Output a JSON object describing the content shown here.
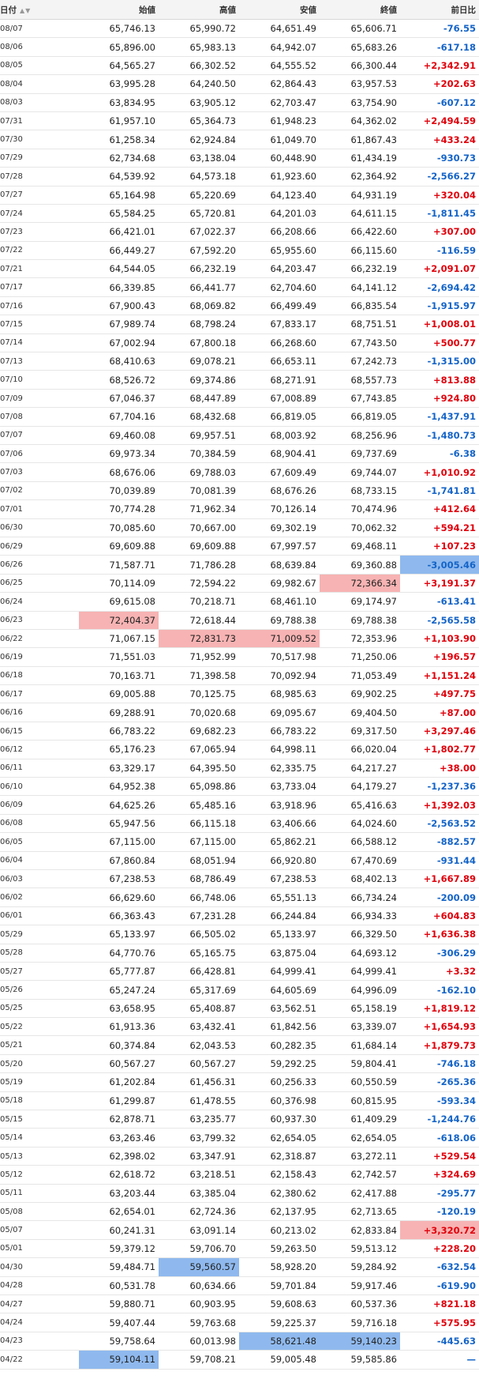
{
  "table": {
    "headers": [
      "日付",
      "始値",
      "高値",
      "安値",
      "終値",
      "前日比"
    ],
    "rows": [
      [
        "08/07",
        "65,746.13",
        "65,990.72",
        "64,651.49",
        "65,606.71",
        "-76.55"
      ],
      [
        "08/06",
        "65,896.00",
        "65,983.13",
        "64,942.07",
        "65,683.26",
        "-617.18"
      ],
      [
        "08/05",
        "64,565.27",
        "66,302.52",
        "64,555.52",
        "66,300.44",
        "+2,342.91"
      ],
      [
        "08/04",
        "63,995.28",
        "64,240.50",
        "62,864.43",
        "63,957.53",
        "+202.63"
      ],
      [
        "08/03",
        "63,834.95",
        "63,905.12",
        "62,703.47",
        "63,754.90",
        "-607.12"
      ],
      [
        "07/31",
        "61,957.10",
        "65,364.73",
        "61,948.23",
        "64,362.02",
        "+2,494.59"
      ],
      [
        "07/30",
        "61,258.34",
        "62,924.84",
        "61,049.70",
        "61,867.43",
        "+433.24"
      ],
      [
        "07/29",
        "62,734.68",
        "63,138.04",
        "60,448.90",
        "61,434.19",
        "-930.73"
      ],
      [
        "07/28",
        "64,539.92",
        "64,573.18",
        "61,923.60",
        "62,364.92",
        "-2,566.27"
      ],
      [
        "07/27",
        "65,164.98",
        "65,220.69",
        "64,123.40",
        "64,931.19",
        "+320.04"
      ],
      [
        "07/24",
        "65,584.25",
        "65,720.81",
        "64,201.03",
        "64,611.15",
        "-1,811.45"
      ],
      [
        "07/23",
        "66,421.01",
        "67,022.37",
        "66,208.66",
        "66,422.60",
        "+307.00"
      ],
      [
        "07/22",
        "66,449.27",
        "67,592.20",
        "65,955.60",
        "66,115.60",
        "-116.59"
      ],
      [
        "07/21",
        "64,544.05",
        "66,232.19",
        "64,203.47",
        "66,232.19",
        "+2,091.07"
      ],
      [
        "07/17",
        "66,339.85",
        "66,441.77",
        "62,704.60",
        "64,141.12",
        "-2,694.42"
      ],
      [
        "07/16",
        "67,900.43",
        "68,069.82",
        "66,499.49",
        "66,835.54",
        "-1,915.97"
      ],
      [
        "07/15",
        "67,989.74",
        "68,798.24",
        "67,833.17",
        "68,751.51",
        "+1,008.01"
      ],
      [
        "07/14",
        "67,002.94",
        "67,800.18",
        "66,268.60",
        "67,743.50",
        "+500.77"
      ],
      [
        "07/13",
        "68,410.63",
        "69,078.21",
        "66,653.11",
        "67,242.73",
        "-1,315.00"
      ],
      [
        "07/10",
        "68,526.72",
        "69,374.86",
        "68,271.91",
        "68,557.73",
        "+813.88"
      ],
      [
        "07/09",
        "67,046.37",
        "68,447.89",
        "67,008.89",
        "67,743.85",
        "+924.80"
      ],
      [
        "07/08",
        "67,704.16",
        "68,432.68",
        "66,819.05",
        "66,819.05",
        "-1,437.91"
      ],
      [
        "07/07",
        "69,460.08",
        "69,957.51",
        "68,003.92",
        "68,256.96",
        "-1,480.73"
      ],
      [
        "07/06",
        "69,973.34",
        "70,384.59",
        "68,904.41",
        "69,737.69",
        "-6.38"
      ],
      [
        "07/03",
        "68,676.06",
        "69,788.03",
        "67,609.49",
        "69,744.07",
        "+1,010.92"
      ],
      [
        "07/02",
        "70,039.89",
        "70,081.39",
        "68,676.26",
        "68,733.15",
        "-1,741.81"
      ],
      [
        "07/01",
        "70,774.28",
        "71,962.34",
        "70,126.14",
        "70,474.96",
        "+412.64"
      ],
      [
        "06/30",
        "70,085.60",
        "70,667.00",
        "69,302.19",
        "70,062.32",
        "+594.21"
      ],
      [
        "06/29",
        "69,609.88",
        "69,609.88",
        "67,997.57",
        "69,468.11",
        "+107.23"
      ],
      [
        "06/26",
        "71,587.71",
        "71,786.28",
        "68,639.84",
        "69,360.88",
        "-3,005.46"
      ],
      [
        "06/25",
        "70,114.09",
        "72,594.22",
        "69,982.67",
        "72,366.34",
        "+3,191.37"
      ],
      [
        "06/24",
        "69,615.08",
        "70,218.71",
        "68,461.10",
        "69,174.97",
        "-613.41"
      ],
      [
        "06/23",
        "72,404.37",
        "72,618.44",
        "69,788.38",
        "69,788.38",
        "-2,565.58"
      ],
      [
        "06/22",
        "71,067.15",
        "72,831.73",
        "71,009.52",
        "72,353.96",
        "+1,103.90"
      ],
      [
        "06/19",
        "71,551.03",
        "71,952.99",
        "70,517.98",
        "71,250.06",
        "+196.57"
      ],
      [
        "06/18",
        "70,163.71",
        "71,398.58",
        "70,092.94",
        "71,053.49",
        "+1,151.24"
      ],
      [
        "06/17",
        "69,005.88",
        "70,125.75",
        "68,985.63",
        "69,902.25",
        "+497.75"
      ],
      [
        "06/16",
        "69,288.91",
        "70,020.68",
        "69,095.67",
        "69,404.50",
        "+87.00"
      ],
      [
        "06/15",
        "66,783.22",
        "69,682.23",
        "66,783.22",
        "69,317.50",
        "+3,297.46"
      ],
      [
        "06/12",
        "65,176.23",
        "67,065.94",
        "64,998.11",
        "66,020.04",
        "+1,802.77"
      ],
      [
        "06/11",
        "63,329.17",
        "64,395.50",
        "62,335.75",
        "64,217.27",
        "+38.00"
      ],
      [
        "06/10",
        "64,952.38",
        "65,098.86",
        "63,733.04",
        "64,179.27",
        "-1,237.36"
      ],
      [
        "06/09",
        "64,625.26",
        "65,485.16",
        "63,918.96",
        "65,416.63",
        "+1,392.03"
      ],
      [
        "06/08",
        "65,947.56",
        "66,115.18",
        "63,406.66",
        "64,024.60",
        "-2,563.52"
      ],
      [
        "06/05",
        "67,115.00",
        "67,115.00",
        "65,862.21",
        "66,588.12",
        "-882.57"
      ],
      [
        "06/04",
        "67,860.84",
        "68,051.94",
        "66,920.80",
        "67,470.69",
        "-931.44"
      ],
      [
        "06/03",
        "67,238.53",
        "68,786.49",
        "67,238.53",
        "68,402.13",
        "+1,667.89"
      ],
      [
        "06/02",
        "66,629.60",
        "66,748.06",
        "65,551.13",
        "66,734.24",
        "-200.09"
      ],
      [
        "06/01",
        "66,363.43",
        "67,231.28",
        "66,244.84",
        "66,934.33",
        "+604.83"
      ],
      [
        "05/29",
        "65,133.97",
        "66,505.02",
        "65,133.97",
        "66,329.50",
        "+1,636.38"
      ],
      [
        "05/28",
        "64,770.76",
        "65,165.75",
        "63,875.04",
        "64,693.12",
        "-306.29"
      ],
      [
        "05/27",
        "65,777.87",
        "66,428.81",
        "64,999.41",
        "64,999.41",
        "+3.32"
      ],
      [
        "05/26",
        "65,247.24",
        "65,317.69",
        "64,605.69",
        "64,996.09",
        "-162.10"
      ],
      [
        "05/25",
        "63,658.95",
        "65,408.87",
        "63,562.51",
        "65,158.19",
        "+1,819.12"
      ],
      [
        "05/22",
        "61,913.36",
        "63,432.41",
        "61,842.56",
        "63,339.07",
        "+1,654.93"
      ],
      [
        "05/21",
        "60,374.84",
        "62,043.53",
        "60,282.35",
        "61,684.14",
        "+1,879.73"
      ],
      [
        "05/20",
        "60,567.27",
        "60,567.27",
        "59,292.25",
        "59,804.41",
        "-746.18"
      ],
      [
        "05/19",
        "61,202.84",
        "61,456.31",
        "60,256.33",
        "60,550.59",
        "-265.36"
      ],
      [
        "05/18",
        "61,299.87",
        "61,478.55",
        "60,376.98",
        "60,815.95",
        "-593.34"
      ],
      [
        "05/15",
        "62,878.71",
        "63,235.77",
        "60,937.30",
        "61,409.29",
        "-1,244.76"
      ],
      [
        "05/14",
        "63,263.46",
        "63,799.32",
        "62,654.05",
        "62,654.05",
        "-618.06"
      ],
      [
        "05/13",
        "62,398.02",
        "63,347.91",
        "62,318.87",
        "63,272.11",
        "+529.54"
      ],
      [
        "05/12",
        "62,618.72",
        "63,218.51",
        "62,158.43",
        "62,742.57",
        "+324.69"
      ],
      [
        "05/11",
        "63,203.44",
        "63,385.04",
        "62,380.62",
        "62,417.88",
        "-295.77"
      ],
      [
        "05/08",
        "62,654.01",
        "62,724.36",
        "62,137.95",
        "62,713.65",
        "-120.19"
      ],
      [
        "05/07",
        "60,241.31",
        "63,091.14",
        "60,213.02",
        "62,833.84",
        "+3,320.72"
      ],
      [
        "05/01",
        "59,379.12",
        "59,706.70",
        "59,263.50",
        "59,513.12",
        "+228.20"
      ],
      [
        "04/30",
        "59,484.71",
        "59,560.57",
        "58,928.20",
        "59,284.92",
        "-632.54"
      ],
      [
        "04/28",
        "60,531.78",
        "60,634.66",
        "59,701.84",
        "59,917.46",
        "-619.90"
      ],
      [
        "04/27",
        "59,880.71",
        "60,903.95",
        "59,608.63",
        "60,537.36",
        "+821.18"
      ],
      [
        "04/24",
        "59,407.44",
        "59,763.68",
        "59,225.37",
        "59,716.18",
        "+575.95"
      ],
      [
        "04/23",
        "59,758.64",
        "60,013.98",
        "58,621.48",
        "59,140.23",
        "-445.63"
      ],
      [
        "04/22",
        "59,104.11",
        "59,708.21",
        "59,005.48",
        "59,585.86",
        "—"
      ]
    ],
    "highlights": {
      "red": [
        [
          "06/23",
          1
        ],
        [
          "06/22",
          2
        ],
        [
          "06/22",
          3
        ],
        [
          "06/25",
          4
        ],
        [
          "05/07",
          5
        ]
      ],
      "blue": [
        [
          "06/26",
          5
        ],
        [
          "04/30",
          2
        ],
        [
          "04/23",
          3
        ],
        [
          "04/23",
          4
        ],
        [
          "04/22",
          1
        ]
      ]
    },
    "colors": {
      "positive": "#e0000b",
      "negative": "#1464c8",
      "highlight_red": "#f7b3b3",
      "highlight_blue": "#8fb9ee"
    }
  }
}
